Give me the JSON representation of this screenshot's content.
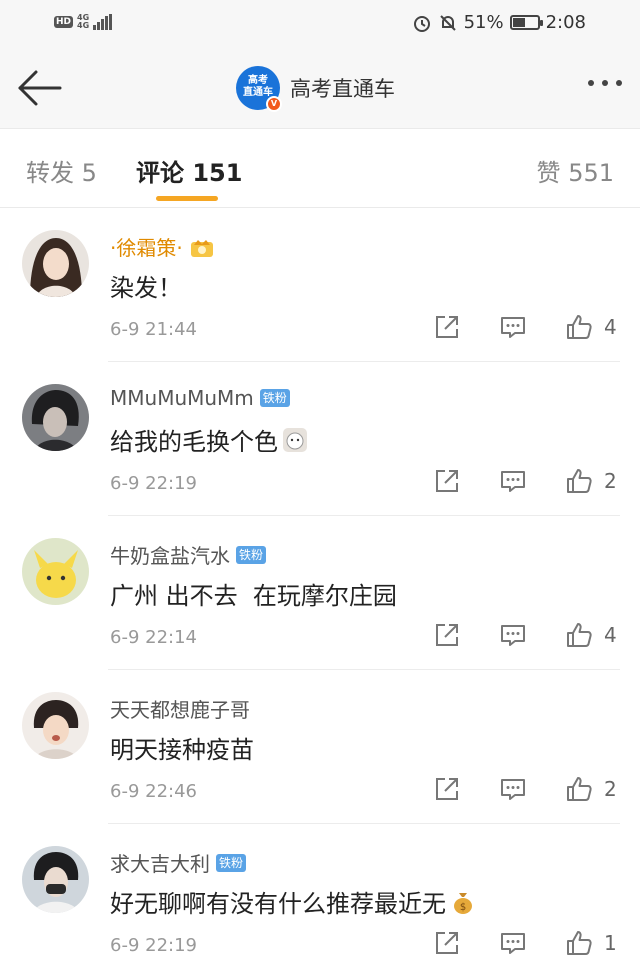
{
  "status_bar": {
    "hd": "HD",
    "network_top": "4G",
    "network_bottom": "4G",
    "battery_percent": "51%",
    "battery_level": 0.51,
    "time": "2:08"
  },
  "nav": {
    "avatar_line1": "高考",
    "avatar_line2": "直通车",
    "verified_badge": "V",
    "title": "高考直通车"
  },
  "tabs": {
    "repost_label": "转发",
    "repost_count": "5",
    "comments_label": "评论",
    "comments_count": "151",
    "likes_label": "赞",
    "likes_count": "551"
  },
  "comments": [
    {
      "username": "·徐霜策·",
      "badge": "",
      "text": "染发！",
      "time": "6-9 21:44",
      "likes": "4"
    },
    {
      "username": "MMuMuMuMm",
      "badge": "铁粉",
      "text": "给我的毛换个色",
      "time": "6-9 22:19",
      "likes": "2"
    },
    {
      "username": "牛奶盒盐汽水",
      "badge": "铁粉",
      "text": "广州 出不去  在玩摩尔庄园",
      "time": "6-9 22:14",
      "likes": "4"
    },
    {
      "username": "天天都想鹿子哥",
      "badge": "",
      "text": "明天接种疫苗",
      "time": "6-9 22:46",
      "likes": "2"
    },
    {
      "username": "求大吉大利",
      "badge": "铁粉",
      "text": "好无聊啊有没有什么推荐最近无",
      "time": "6-9 22:19",
      "likes": "1"
    }
  ],
  "icons": {
    "back": "arrow-left-icon",
    "more": "more-dots-icon",
    "share": "share-icon",
    "reply": "reply-bubble-icon",
    "like": "thumbs-up-icon"
  },
  "colors": {
    "accent": "#f5a623",
    "gold_username": "#e08a00",
    "fan_badge": "#5aa3e6",
    "brand_blue": "#1a73d9"
  }
}
